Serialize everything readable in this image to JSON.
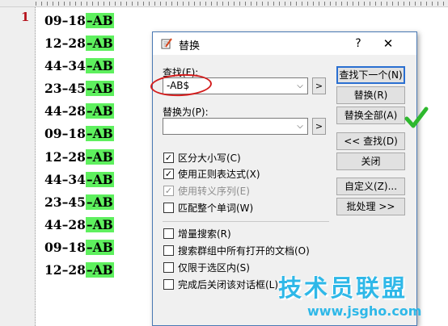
{
  "editor": {
    "line_number": "1",
    "lines": [
      {
        "prefix": "09–18",
        "highlight": "–AB"
      },
      {
        "prefix": "12–28",
        "highlight": "–AB"
      },
      {
        "prefix": "44–34",
        "highlight": "–AB"
      },
      {
        "prefix": "23–45",
        "highlight": "–AB"
      },
      {
        "prefix": "44–28",
        "highlight": "–AB"
      },
      {
        "prefix": "09–18",
        "highlight": "–AB"
      },
      {
        "prefix": "12–28",
        "highlight": "–AB"
      },
      {
        "prefix": "44–34",
        "highlight": "–AB"
      },
      {
        "prefix": "23–45",
        "highlight": "–AB"
      },
      {
        "prefix": "44–28",
        "highlight": "–AB"
      },
      {
        "prefix": "09–18",
        "highlight": "–AB"
      },
      {
        "prefix": "12–28",
        "highlight": "–AB"
      }
    ],
    "highlight_color": "#5ef05e"
  },
  "dialog": {
    "title": "替换",
    "help": "?",
    "close": "✕",
    "find_label": "查找(F):",
    "find_value": "-AB$",
    "replace_label": "替换为(P):",
    "replace_value": "",
    "arrow_button": ">",
    "options": {
      "match_case": {
        "label": "区分大小写(C)",
        "checked": true
      },
      "regex": {
        "label": "使用正则表达式(X)",
        "checked": true
      },
      "escape": {
        "label": "使用转义序列(E)",
        "checked": true,
        "disabled": true
      },
      "whole_word": {
        "label": "匹配整个单词(W)",
        "checked": false
      }
    },
    "search_options": {
      "incremental": {
        "label": "增量搜索(R)",
        "checked": false
      },
      "all_docs": {
        "label": "搜索群组中所有打开的文档(O)",
        "checked": false
      },
      "selection": {
        "label": "仅限于选区内(S)",
        "checked": false
      },
      "close_after": {
        "label": "完成后关闭该对话框(L)",
        "checked": false
      }
    },
    "buttons": {
      "find_next": "查找下一个(N)",
      "replace": "替换(R)",
      "replace_all": "替换全部(A)",
      "less_find": "<< 查找(D)",
      "close": "关闭",
      "custom": "自定义(Z)...",
      "batch": "批处理 >>"
    }
  },
  "watermark": {
    "title": "技术员联盟",
    "url": "www.jsgho.com"
  },
  "colors": {
    "accent": "#2a6fd1",
    "annotation_red": "#d31d1d",
    "check_green": "#2eb82e",
    "watermark_blue": "#2fb8e8"
  }
}
